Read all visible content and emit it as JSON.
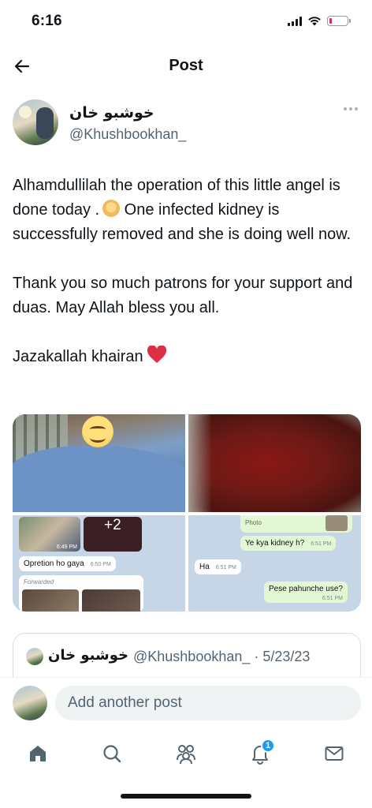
{
  "status_bar": {
    "time": "6:16"
  },
  "header": {
    "title": "Post"
  },
  "author": {
    "display_name": "خوشبو خان",
    "handle": "@Khushbookhan_"
  },
  "post": {
    "paragraphs": [
      "Alhamdullilah the operation of this little angel is done today .",
      "One infected kidney is successfully removed and she is doing well now.",
      "Thank you so much patrons for your support and duas. May Allah bless you all.",
      "Jazakallah khairan"
    ]
  },
  "media": {
    "chat_left": {
      "photo_time": "6:49 PM",
      "more_count": "+2",
      "message": "Opretion ho gaya",
      "message_time": "6:50 PM",
      "forwarded_label": "Forwarded"
    },
    "chat_right": {
      "photo_label": "Photo",
      "msg1": "Ye kya kidney h?",
      "msg1_time": "6:51 PM",
      "msg2": "Ha",
      "msg2_time": "6:51 PM",
      "msg3": "Pese pahunche use?",
      "msg3_time": "6:51 PM"
    }
  },
  "quoted_post": {
    "display_name": "خوشبو خان",
    "handle_date": "@Khushbookhan_ · 5/23/23"
  },
  "compose": {
    "placeholder": "Add another post"
  },
  "bottom_nav": {
    "items": [
      "home",
      "search",
      "communities",
      "notifications",
      "messages"
    ],
    "notification_count": "1"
  },
  "colors": {
    "accent": "#1d9bf0",
    "heart": "#e0245e"
  }
}
